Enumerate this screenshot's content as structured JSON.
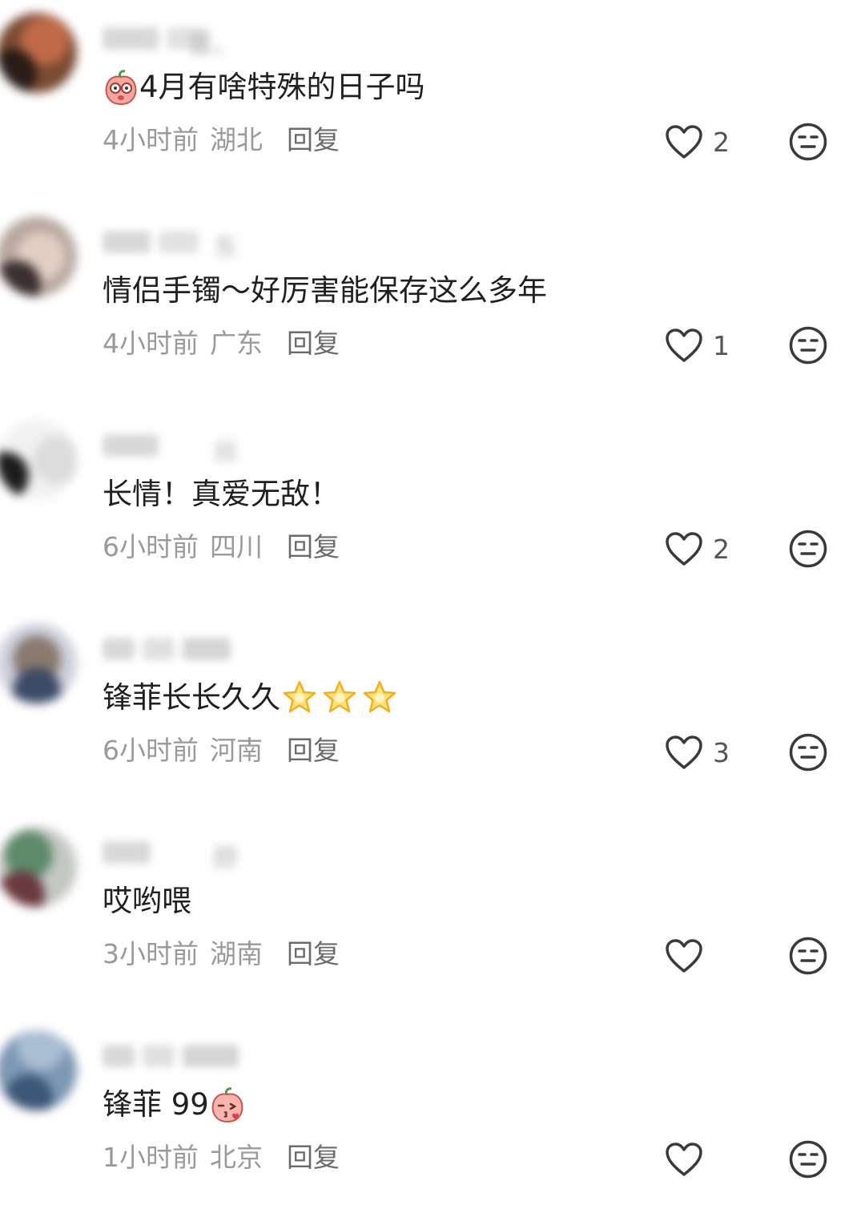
{
  "comments": [
    {
      "username_tail": "督。",
      "text": "4月有啥特殊的日子吗",
      "leading_emoji": "peach-emoji-thinking",
      "trailing_emoji": "",
      "time": "4小时前",
      "location": "湖北",
      "reply_label": "回复",
      "likes": "2"
    },
    {
      "username_tail": "东",
      "text": "情侣手镯～好厉害能保存这么多年",
      "leading_emoji": "",
      "trailing_emoji": "",
      "time": "4小时前",
      "location": "广东",
      "reply_label": "回复",
      "likes": "1"
    },
    {
      "username_tail": "丝",
      "text": "长情！真爱无敌！",
      "leading_emoji": "",
      "trailing_emoji": "",
      "time": "6小时前",
      "location": "四川",
      "reply_label": "回复",
      "likes": "2"
    },
    {
      "username_tail": "",
      "text": "锋菲长长久久",
      "leading_emoji": "",
      "trailing_emoji": "star-emoji-x3",
      "time": "6小时前",
      "location": "河南",
      "reply_label": "回复",
      "likes": "3"
    },
    {
      "username_tail": "脖",
      "text": "哎哟喂",
      "leading_emoji": "",
      "trailing_emoji": "",
      "time": "3小时前",
      "location": "湖南",
      "reply_label": "回复",
      "likes": ""
    },
    {
      "username_tail": "",
      "text": "锋菲 99",
      "leading_emoji": "",
      "trailing_emoji": "peach-emoji-kiss",
      "time": "1小时前",
      "location": "北京",
      "reply_label": "回复",
      "likes": ""
    }
  ],
  "icons": {
    "like": "heart-outline-icon",
    "dislike": "meh-face-icon"
  },
  "colors": {
    "text": "#202020",
    "meta": "#9a9a9a",
    "reply": "#6b6b6b",
    "icon": "#3a3a3a"
  }
}
